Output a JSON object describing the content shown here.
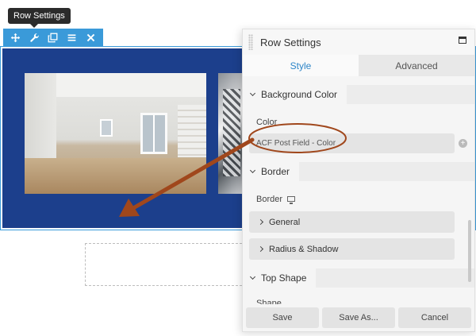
{
  "tooltip": {
    "text": "Row Settings"
  },
  "toolbar": {
    "items": [
      {
        "name": "move-icon"
      },
      {
        "name": "wrench-icon"
      },
      {
        "name": "duplicate-icon"
      },
      {
        "name": "menu-icon"
      },
      {
        "name": "close-icon"
      }
    ]
  },
  "panel": {
    "title": "Row Settings",
    "tabs": [
      {
        "label": "Style",
        "active": true
      },
      {
        "label": "Advanced",
        "active": false
      }
    ],
    "sections": {
      "background_color": {
        "title": "Background Color",
        "color_label": "Color",
        "color_value": "ACF Post Field - Color"
      },
      "border": {
        "title": "Border",
        "border_label": "Border",
        "subsections": [
          "General",
          "Radius & Shadow"
        ]
      },
      "top_shape": {
        "title": "Top Shape",
        "shape_label": "Shape"
      }
    },
    "footer": {
      "save": "Save",
      "save_as": "Save As...",
      "cancel": "Cancel"
    }
  },
  "colors": {
    "row_background": "#1c3f8c",
    "toolbar": "#3a9ad9",
    "accent_tab": "#2e86c8",
    "annotation": "#a0471c"
  }
}
